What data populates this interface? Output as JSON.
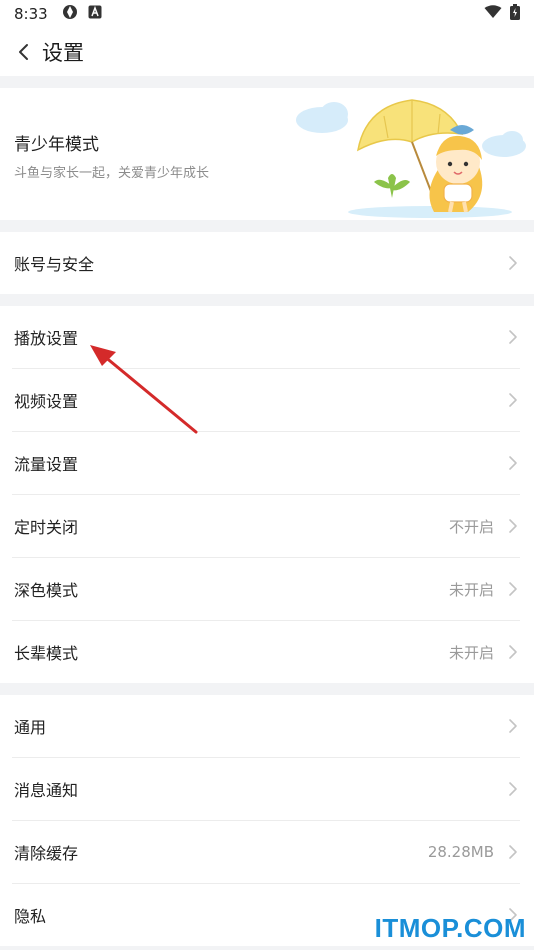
{
  "status_bar": {
    "time": "8:33"
  },
  "header": {
    "title": "设置"
  },
  "youth_mode": {
    "title": "青少年模式",
    "subtitle": "斗鱼与家长一起，关爱青少年成长"
  },
  "group_account": [
    {
      "label": "账号与安全",
      "value": ""
    }
  ],
  "group_playback": [
    {
      "label": "播放设置",
      "value": ""
    },
    {
      "label": "视频设置",
      "value": ""
    },
    {
      "label": "流量设置",
      "value": ""
    },
    {
      "label": "定时关闭",
      "value": "不开启"
    },
    {
      "label": "深色模式",
      "value": "未开启"
    },
    {
      "label": "长辈模式",
      "value": "未开启"
    }
  ],
  "group_general": [
    {
      "label": "通用",
      "value": ""
    },
    {
      "label": "消息通知",
      "value": ""
    },
    {
      "label": "清除缓存",
      "value": "28.28MB"
    },
    {
      "label": "隐私",
      "value": ""
    }
  ],
  "watermark": "ITMOP.COM",
  "colors": {
    "arrow": "#d42a2a",
    "watermark": "#1a8fd8",
    "background": "#f2f3f5"
  }
}
